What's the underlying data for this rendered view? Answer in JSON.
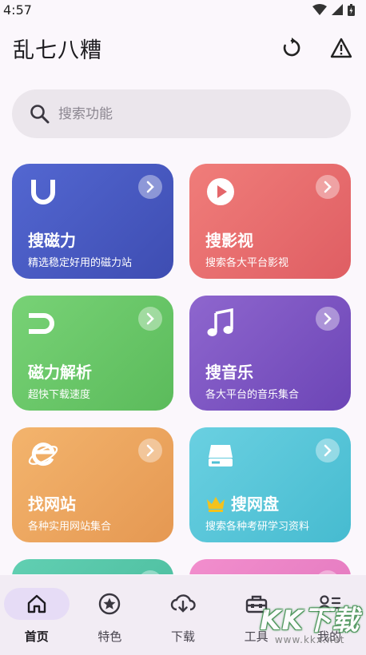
{
  "status_bar": {
    "time": "4:57"
  },
  "app_bar": {
    "title": "乱七八糟",
    "refresh_icon": "refresh-icon",
    "warning_icon": "warning-icon"
  },
  "search": {
    "placeholder": "搜索功能"
  },
  "cards": [
    {
      "title": "搜磁力",
      "subtitle": "精选稳定好用的磁力站",
      "icon": "magnet-u-icon",
      "color_start": "#5166cf",
      "color_end": "#3f4fb3"
    },
    {
      "title": "搜影视",
      "subtitle": "搜索各大平台影视",
      "icon": "play-circle-icon",
      "color_start": "#ef7a78",
      "color_end": "#e05f64"
    },
    {
      "title": "磁力解析",
      "subtitle": "超快下载速度",
      "icon": "magnet-icon",
      "color_start": "#74cf72",
      "color_end": "#5cbd5c"
    },
    {
      "title": "搜音乐",
      "subtitle": "各大平台的音乐集合",
      "icon": "music-note-icon",
      "color_start": "#8b62cc",
      "color_end": "#6f47b8"
    },
    {
      "title": "找网站",
      "subtitle": "各种实用网站集合",
      "icon": "browser-e-icon",
      "color_start": "#f2b26b",
      "color_end": "#e69a53"
    },
    {
      "title": "搜网盘",
      "subtitle": "搜索各种考研学习资料",
      "icon": "hard-drive-icon",
      "color_start": "#67cfe0",
      "color_end": "#48bdd2",
      "badge_icon": "crown-icon"
    },
    {
      "title": "",
      "subtitle": "",
      "icon": "",
      "color_start": "#5fcdb0",
      "color_end": "#49bb9c"
    },
    {
      "title": "",
      "subtitle": "",
      "icon": "",
      "color_start": "#f08ccc",
      "color_end": "#e275bd"
    }
  ],
  "nav": [
    {
      "label": "首页",
      "icon": "home-icon",
      "active": true
    },
    {
      "label": "特色",
      "icon": "star-circle-icon",
      "active": false
    },
    {
      "label": "下载",
      "icon": "cloud-download-icon",
      "active": false
    },
    {
      "label": "工具",
      "icon": "toolbox-icon",
      "active": false
    },
    {
      "label": "我的",
      "icon": "profile-list-icon",
      "active": false
    }
  ],
  "watermark": {
    "text": "KK下载",
    "url": "www.kkx.net"
  }
}
